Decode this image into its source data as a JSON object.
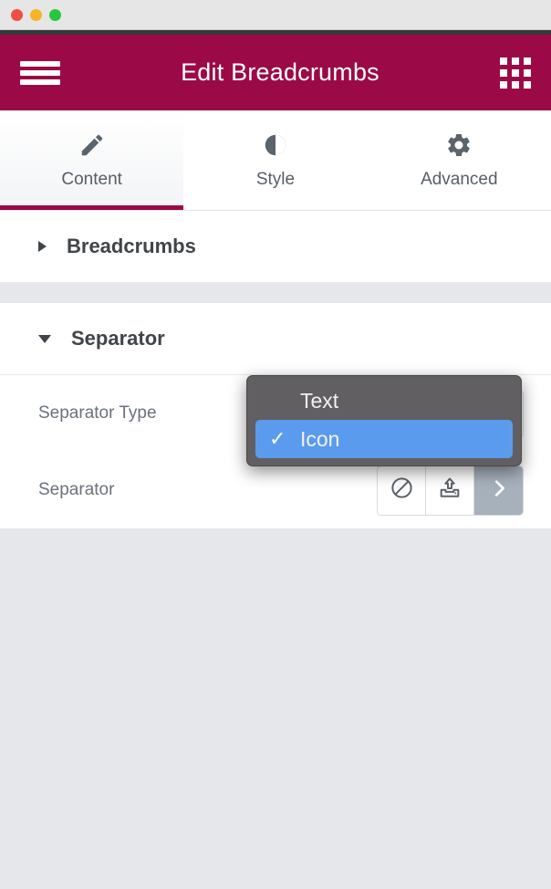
{
  "window": {
    "traffic_lights": [
      "close",
      "minimize",
      "zoom"
    ],
    "colors": {
      "header_crimson": "#9b0a46",
      "titlebar_gray": "#e6e6e6",
      "panel_white": "#ffffff",
      "page_gray": "#e6e7eb",
      "popup_dark": "#615f61",
      "popup_highlight_blue": "#5a9bed",
      "choice_selected_gray": "#a7b1bc"
    }
  },
  "header": {
    "title": "Edit Breadcrumbs",
    "menu_icon": "hamburger-icon",
    "apps_icon": "grid-icon"
  },
  "tabs": [
    {
      "label": "Content",
      "icon": "pencil-icon",
      "active": true
    },
    {
      "label": "Style",
      "icon": "contrast-icon",
      "active": false
    },
    {
      "label": "Advanced",
      "icon": "gear-icon",
      "active": false
    }
  ],
  "sections": [
    {
      "title": "Breadcrumbs",
      "expanded": false,
      "toggle_icon": "triangle-right-icon"
    },
    {
      "title": "Separator",
      "expanded": true,
      "toggle_icon": "triangle-down-icon"
    }
  ],
  "controls": {
    "separator_type": {
      "label": "Separator Type",
      "value": "Icon",
      "options": [
        "Text",
        "Icon"
      ]
    },
    "separator": {
      "label": "Separator",
      "choices": [
        {
          "icon": "ban-icon",
          "name": "none",
          "selected": false
        },
        {
          "icon": "upload-icon",
          "name": "upload",
          "selected": false
        },
        {
          "icon": "chevron-right-icon",
          "name": "chevron-right",
          "selected": true
        }
      ]
    }
  },
  "dropdown": {
    "open": true,
    "items": [
      {
        "label": "Text",
        "selected": false
      },
      {
        "label": "Icon",
        "selected": true,
        "check": "✓"
      }
    ]
  }
}
